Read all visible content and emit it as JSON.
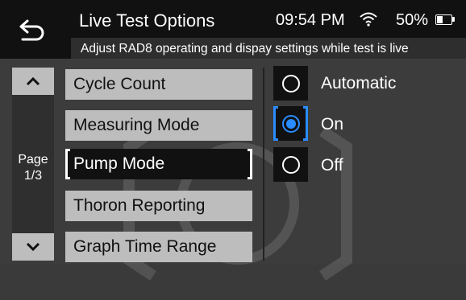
{
  "header": {
    "title": "Live Test Options",
    "time": "09:54 PM",
    "battery": "50%",
    "battery_level": 0.5,
    "subtitle": "Adjust RAD8 operating and dispay settings while test is live"
  },
  "pager": {
    "label_line1": "Page",
    "label_line2": "1/3"
  },
  "menu": {
    "items": [
      {
        "label": "Cycle Count"
      },
      {
        "label": "Measuring Mode"
      },
      {
        "label": "Pump Mode"
      },
      {
        "label": "Thoron Reporting"
      },
      {
        "label": "Graph Time Range"
      }
    ],
    "selected": "Pump Mode"
  },
  "options": {
    "items": [
      {
        "label": "Automatic"
      },
      {
        "label": "On"
      },
      {
        "label": "Off"
      }
    ],
    "selected": "On"
  },
  "colors": {
    "accent": "#2a8cff",
    "header_bg": "#111111",
    "item_bg": "#bdbdbd"
  },
  "icons": [
    "back-arrow-icon",
    "wifi-icon",
    "battery-icon",
    "chevron-up-icon",
    "chevron-down-icon",
    "radon-logo-watermark"
  ]
}
